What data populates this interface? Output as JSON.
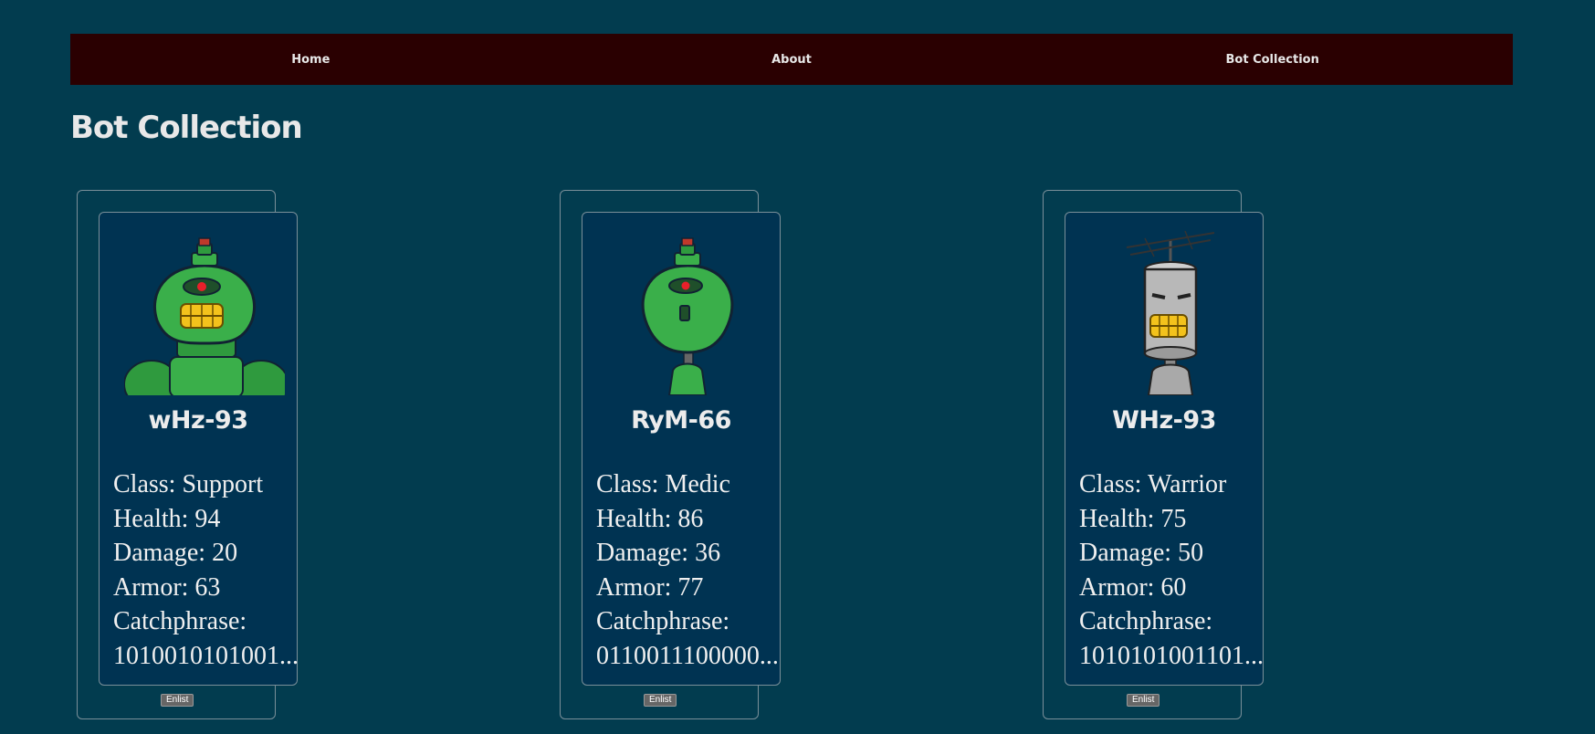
{
  "nav": {
    "home": "Home",
    "about": "About",
    "collection": "Bot Collection"
  },
  "page_title": "Bot Collection",
  "bots": [
    {
      "name": "wHz-93",
      "class": "Class: Support",
      "health": "Health: 94",
      "damage": "Damage: 20",
      "armor": "Armor: 63",
      "catchphrase_label": "Catchphrase:",
      "catchphrase": "1010010101001...",
      "enlist": "Enlist",
      "avatar": "green-robot-avatar"
    },
    {
      "name": "RyM-66",
      "class": "Class: Medic",
      "health": "Health: 86",
      "damage": "Damage: 36",
      "armor": "Armor: 77",
      "catchphrase_label": "Catchphrase:",
      "catchphrase": "0110011100000...",
      "enlist": "Enlist",
      "avatar": "green-robot-avatar"
    },
    {
      "name": "WHz-93",
      "class": "Class: Warrior",
      "health": "Health: 75",
      "damage": "Damage: 50",
      "armor": "Armor: 60",
      "catchphrase_label": "Catchphrase:",
      "catchphrase": "1010101001101...",
      "enlist": "Enlist",
      "avatar": "gray-robot-avatar"
    }
  ],
  "colors": {
    "background": "#023c4f",
    "navbar": "#2a0001",
    "card": "#003352",
    "robot_green": "#3aaf4a",
    "robot_gray": "#b8b8b8"
  }
}
